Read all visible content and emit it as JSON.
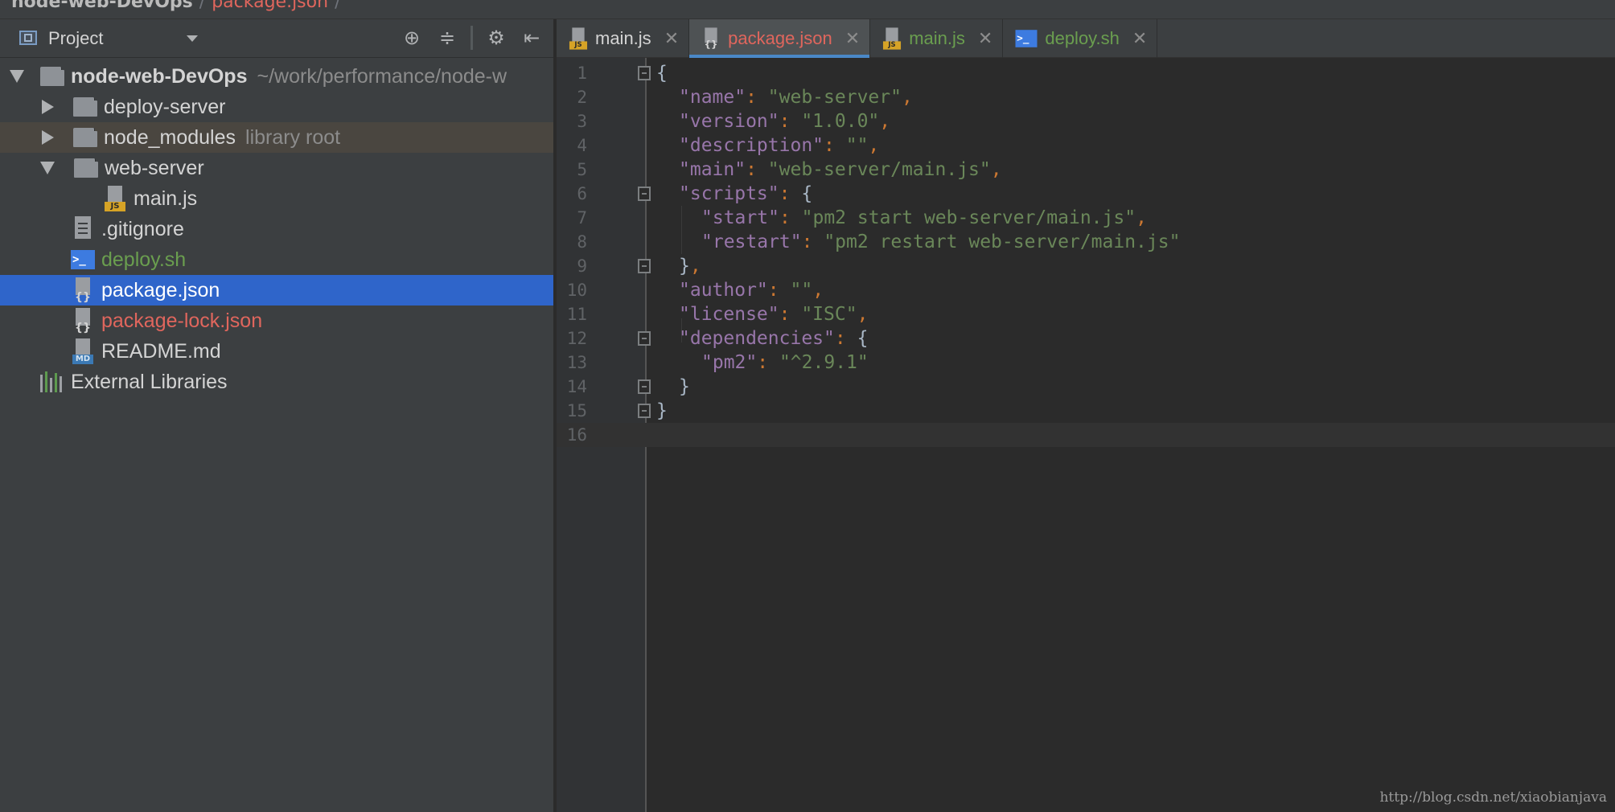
{
  "breadcrumb": {
    "root": "node-web-DevOps",
    "file": "package.json"
  },
  "project_panel": {
    "title": "Project",
    "tree": [
      {
        "label": "node-web-DevOps",
        "hint": "~/work/performance/node-w"
      },
      {
        "label": "deploy-server"
      },
      {
        "label": "node_modules",
        "hint": "library root"
      },
      {
        "label": "web-server"
      },
      {
        "label": "main.js"
      },
      {
        "label": ".gitignore"
      },
      {
        "label": "deploy.sh"
      },
      {
        "label": "package.json"
      },
      {
        "label": "package-lock.json"
      },
      {
        "label": "README.md"
      },
      {
        "label": "External Libraries"
      }
    ]
  },
  "tabs": [
    {
      "label": "main.js"
    },
    {
      "label": "package.json"
    },
    {
      "label": "main.js"
    },
    {
      "label": "deploy.sh"
    }
  ],
  "editor": {
    "line_numbers": [
      "1",
      "2",
      "3",
      "4",
      "5",
      "6",
      "7",
      "8",
      "9",
      "10",
      "11",
      "12",
      "13",
      "14",
      "15",
      "16"
    ],
    "lines": [
      {
        "open": "{"
      },
      {
        "key": "\"name\"",
        "colon": ": ",
        "val": "\"web-server\"",
        "end": ","
      },
      {
        "key": "\"version\"",
        "colon": ": ",
        "val": "\"1.0.0\"",
        "end": ","
      },
      {
        "key": "\"description\"",
        "colon": ": ",
        "val": "\"\"",
        "end": ","
      },
      {
        "key": "\"main\"",
        "colon": ": ",
        "val": "\"web-server/main.js\"",
        "end": ","
      },
      {
        "key": "\"scripts\"",
        "colon": ": ",
        "brace": "{"
      },
      {
        "key": "\"start\"",
        "colon": ": ",
        "val": "\"pm2 start web-server/main.js\"",
        "end": ","
      },
      {
        "key": "\"restart\"",
        "colon": ": ",
        "val": "\"pm2 restart web-server/main.js\""
      },
      {
        "close": "}",
        "end": ","
      },
      {
        "key": "\"author\"",
        "colon": ": ",
        "val": "\"\"",
        "end": ","
      },
      {
        "key": "\"license\"",
        "colon": ": ",
        "val": "\"ISC\"",
        "end": ","
      },
      {
        "key": "\"dependencies\"",
        "colon": ": ",
        "brace": "{"
      },
      {
        "key": "\"pm2\"",
        "colon": ": ",
        "val": "\"^2.9.1\""
      },
      {
        "close": "}"
      },
      {
        "open": "}"
      },
      {}
    ]
  },
  "watermark": "http://blog.csdn.net/xiaobianjava",
  "colors": {
    "key": "#9876aa",
    "string": "#6a8759",
    "punct": "#cc7832",
    "selection": "#2f65ca",
    "modified_red": "#e0665d",
    "new_green": "#6a9e4f"
  }
}
